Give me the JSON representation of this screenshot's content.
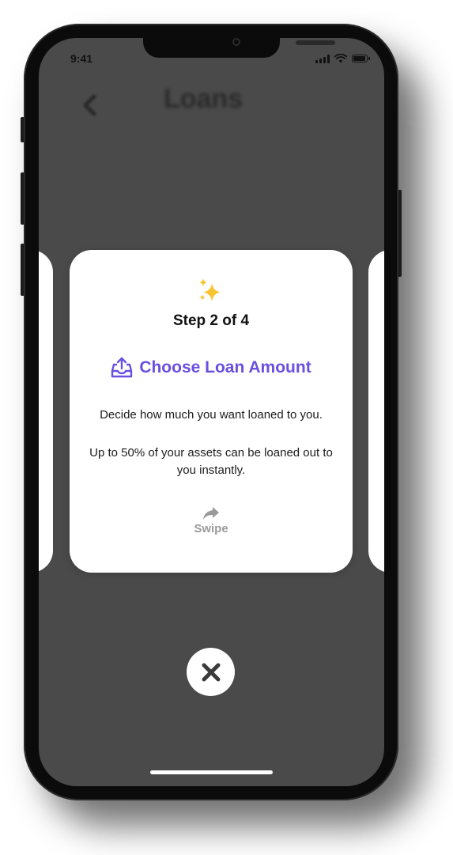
{
  "status_bar": {
    "time": "9:41"
  },
  "nav": {
    "title": "Loans",
    "back_icon": "chevron-left-icon"
  },
  "card": {
    "emoji_icon": "sparkles-icon",
    "step_label": "Step 2 of 4",
    "heading": "Choose Loan Amount",
    "heading_icon": "tray-upload-icon",
    "description_1": "Decide how much you want loaned to you.",
    "description_2": "Up to 50% of your assets can be loaned out to you instantly.",
    "swipe_label": "Swipe",
    "swipe_icon": "share-arrow-icon"
  },
  "close_icon": "close-icon",
  "colors": {
    "accent": "#6b4fe0",
    "screen_background": "#4a4a4a",
    "card_background": "#ffffff",
    "sparkle": "#f7c531",
    "muted": "#9a9a9a"
  }
}
